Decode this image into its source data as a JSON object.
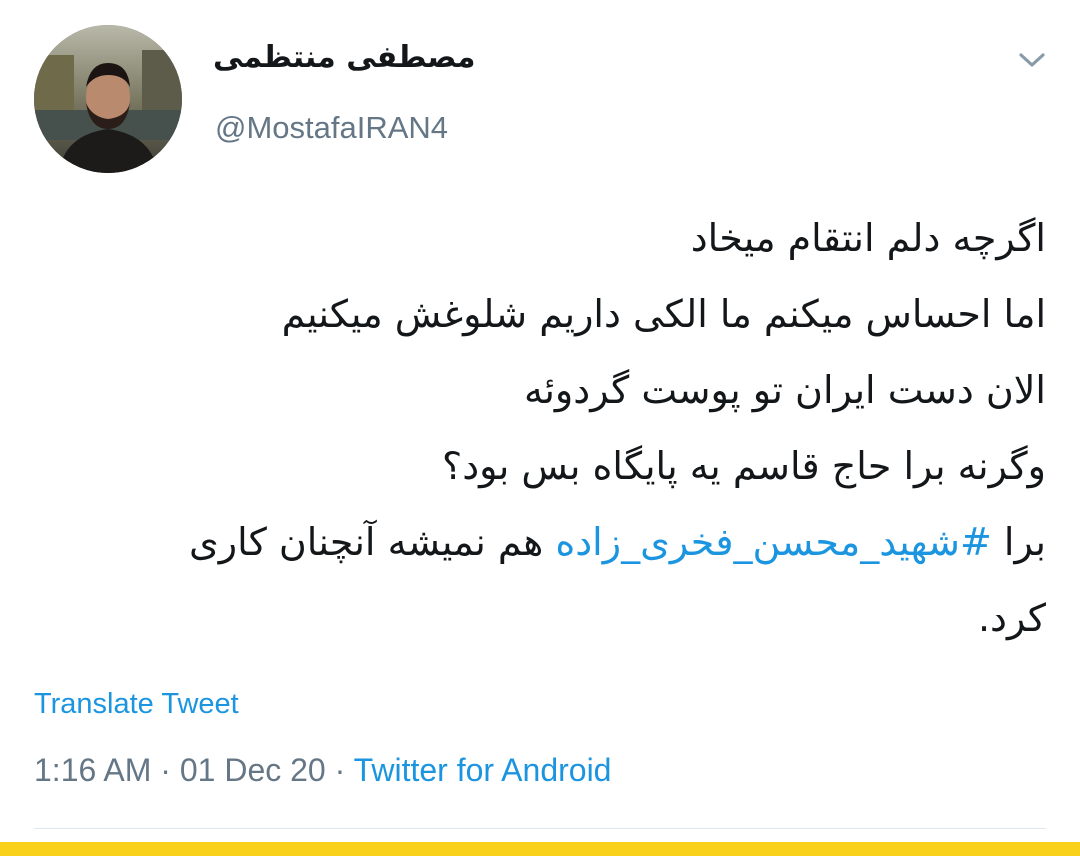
{
  "author": {
    "display_name": "مصطفی منتظمی",
    "handle": "@MostafaIRAN4",
    "avatar_icon": "profile-photo"
  },
  "menu": {
    "icon": "chevron-down-icon"
  },
  "tweet": {
    "lines": [
      "اگرچه دلم انتقام میخاد",
      "اما احساس میکنم ما الکی داریم شلوغش میکنیم",
      "الان دست ایران تو پوست گردوئه",
      "وگرنه برا حاج قاسم یه پایگاه بس بود؟"
    ],
    "line5_before": "برا ",
    "hashtag": "#شهید_محسن_فخری_زاده",
    "line5_after": " هم نمیشه آنچنان کاری",
    "line6": "کرد."
  },
  "translate_label": "Translate Tweet",
  "meta": {
    "time": "1:16 AM",
    "separator": " · ",
    "date": "01 Dec 20",
    "source": "Twitter for Android"
  },
  "colors": {
    "link": "#1b95e0",
    "secondary_text": "#657786",
    "primary_text": "#14171a",
    "divider": "#e1e8ed",
    "accent_bar": "#f9d11a"
  }
}
